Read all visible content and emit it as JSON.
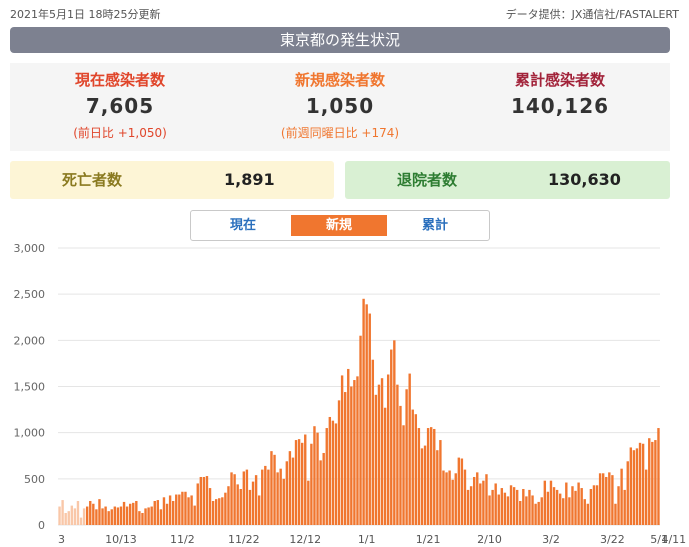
{
  "header": {
    "updated": "2021年5月1日 18時25分更新",
    "source": "データ提供：JX通信社/FASTALERT",
    "title": "東京都の発生状況"
  },
  "stats": {
    "current": {
      "label": "現在感染者数",
      "value": "7,605",
      "sub": "(前日比 +1,050)"
    },
    "new": {
      "label": "新規感染者数",
      "value": "1,050",
      "sub": "(前週同曜日比 +174)"
    },
    "total": {
      "label": "累計感染者数",
      "value": "140,126"
    }
  },
  "deaths": {
    "label": "死亡者数",
    "value": "1,891"
  },
  "recovered": {
    "label": "退院者数",
    "value": "130,630"
  },
  "tabs": [
    {
      "label": "現在",
      "active": false
    },
    {
      "label": "新規",
      "active": true
    },
    {
      "label": "累計",
      "active": false
    }
  ],
  "colors": {
    "bar": "#f0762f",
    "bar_early": "#f9c7a8",
    "grid": "#e5e5e5",
    "accent_red": "#e0452a"
  },
  "chart_data": {
    "type": "bar",
    "title": "",
    "xlabel": "",
    "ylabel": "",
    "ylim": [
      0,
      3000
    ],
    "yticks": [
      "0",
      "500",
      "1,000",
      "1,500",
      "2,000",
      "2,500",
      "3,000"
    ],
    "xticks": [
      "3",
      "10/13",
      "11/2",
      "11/22",
      "12/12",
      "1/1",
      "1/21",
      "2/10",
      "3/2",
      "3/22",
      "4/11",
      "5/1"
    ],
    "x_start": "10/3",
    "x_end": "5/1",
    "series": [
      {
        "values": [
          200,
          270,
          130,
          150,
          210,
          180,
          260,
          80,
          180,
          200,
          260,
          230,
          170,
          280,
          180,
          200,
          150,
          170,
          200,
          190,
          200,
          250,
          200,
          230,
          240,
          260,
          150,
          130,
          180,
          190,
          200,
          260,
          270,
          170,
          300,
          230,
          320,
          260,
          330,
          330,
          360,
          360,
          300,
          320,
          210,
          450,
          520,
          520,
          530,
          400,
          260,
          280,
          290,
          300,
          350,
          420,
          570,
          550,
          440,
          390,
          580,
          600,
          380,
          470,
          540,
          320,
          600,
          640,
          600,
          800,
          760,
          570,
          610,
          500,
          690,
          800,
          730,
          920,
          930,
          890,
          980,
          480,
          880,
          1070,
          1000,
          700,
          780,
          1050,
          1170,
          1130,
          1100,
          1350,
          1620,
          1440,
          1690,
          1500,
          1570,
          1610,
          2050,
          2450,
          2390,
          2290,
          1790,
          1410,
          1520,
          1590,
          1270,
          1630,
          1900,
          2000,
          1520,
          1290,
          1080,
          1470,
          1640,
          1250,
          1200,
          1050,
          830,
          860,
          1050,
          1060,
          1040,
          810,
          920,
          590,
          570,
          590,
          490,
          560,
          730,
          720,
          600,
          380,
          420,
          520,
          570,
          450,
          480,
          550,
          320,
          380,
          450,
          330,
          400,
          350,
          310,
          430,
          410,
          380,
          260,
          390,
          310,
          380,
          320,
          230,
          250,
          300,
          480,
          360,
          480,
          410,
          380,
          340,
          290,
          460,
          300,
          420,
          370,
          460,
          400,
          280,
          230,
          390,
          430,
          430,
          560,
          560,
          520,
          570,
          540,
          230,
          420,
          610,
          380,
          690,
          840,
          810,
          830,
          890,
          880,
          600,
          940,
          900,
          920,
          1050
        ]
      }
    ]
  }
}
